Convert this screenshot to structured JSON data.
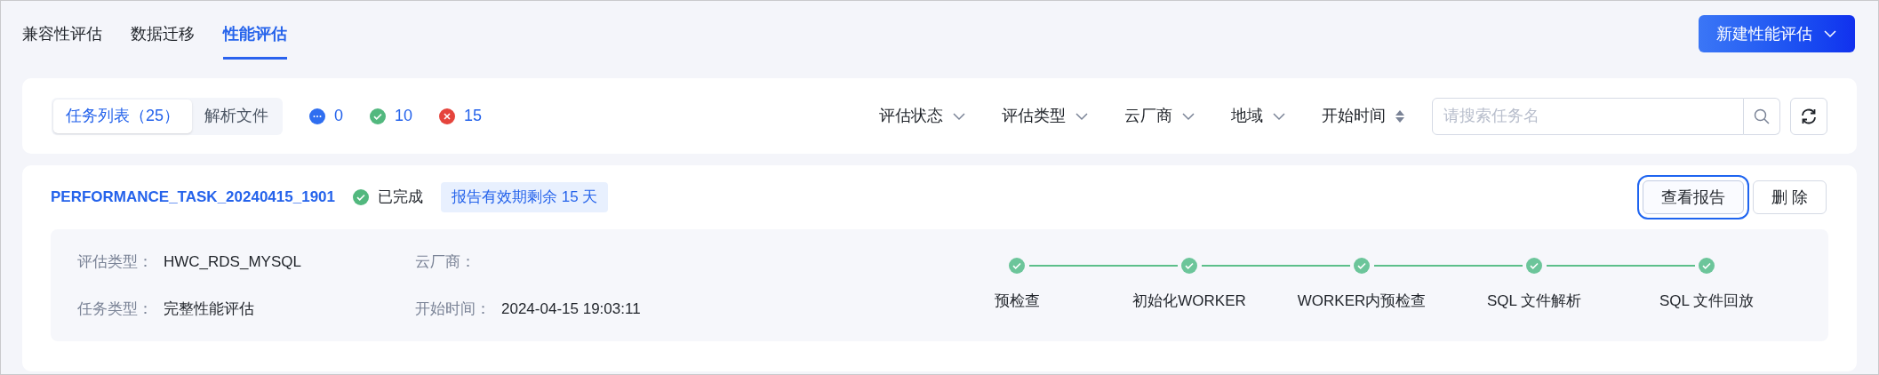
{
  "tabs": [
    {
      "label": "兼容性评估",
      "selected": false
    },
    {
      "label": "数据迁移",
      "selected": false
    },
    {
      "label": "性能评估",
      "selected": true
    }
  ],
  "new_button": {
    "label": "新建性能评估"
  },
  "toolbar": {
    "views": [
      {
        "label": "任务列表（25）",
        "selected": true
      },
      {
        "label": "解析文件",
        "selected": false
      }
    ],
    "counts": [
      {
        "kind": "running",
        "value": "0"
      },
      {
        "kind": "success",
        "value": "10"
      },
      {
        "kind": "failed",
        "value": "15"
      }
    ],
    "filters": [
      {
        "label": "评估状态",
        "kind": "dropdown"
      },
      {
        "label": "评估类型",
        "kind": "dropdown"
      },
      {
        "label": "云厂商",
        "kind": "dropdown"
      },
      {
        "label": "地域",
        "kind": "dropdown"
      },
      {
        "label": "开始时间",
        "kind": "sort"
      }
    ],
    "search": {
      "placeholder": "请搜索任务名"
    }
  },
  "task": {
    "name": "PERFORMANCE_TASK_20240415_1901",
    "status": "已完成",
    "validity": "报告有效期剩余 15 天",
    "actions": [
      {
        "label": "查看报告",
        "focused": true
      },
      {
        "label": "删 除",
        "focused": false
      }
    ],
    "fields": [
      {
        "label": "评估类型：",
        "value": "HWC_RDS_MYSQL"
      },
      {
        "label": "云厂商："
      },
      {
        "label": "任务类型：",
        "value": "完整性能评估"
      },
      {
        "label": "开始时间：",
        "value": "2024-04-15 19:03:11"
      }
    ],
    "steps": [
      {
        "label": "预检查",
        "done": true
      },
      {
        "label": "初始化WORKER",
        "done": true
      },
      {
        "label": "WORKER内预检查",
        "done": true
      },
      {
        "label": "SQL 文件解析",
        "done": true
      },
      {
        "label": "SQL 文件回放",
        "done": true
      }
    ]
  }
}
